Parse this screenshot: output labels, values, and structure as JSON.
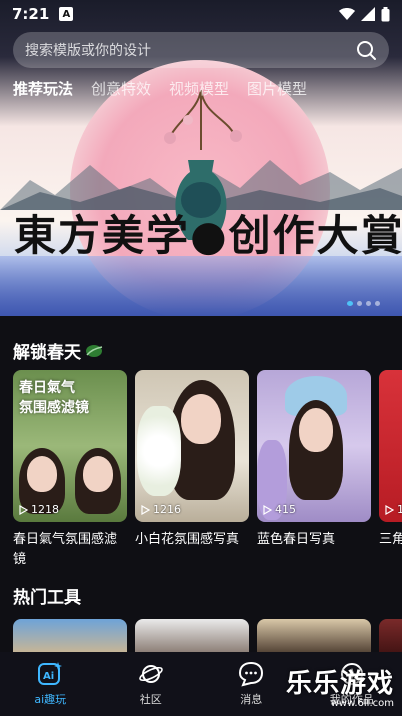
{
  "status_bar": {
    "time": "7:21",
    "notification_letter": "A"
  },
  "search": {
    "placeholder": "搜索模版或你的设计"
  },
  "top_tabs": [
    {
      "label": "推荐玩法",
      "active": true
    },
    {
      "label": "创意特效",
      "active": false
    },
    {
      "label": "视频模型",
      "active": false
    },
    {
      "label": "图片模型",
      "active": false
    }
  ],
  "banner": {
    "title": "東方美学",
    "title_right": "创作大賞",
    "slides": 4,
    "current_slide": 1
  },
  "section_spring": {
    "title": "解锁春天",
    "cards": [
      {
        "overlay": "春日氣气\n氛围感滤镜",
        "count": "1218",
        "label": "春日氣气氛围感滤镜"
      },
      {
        "overlay": "",
        "count": "1216",
        "label": "小白花氛围感写真"
      },
      {
        "overlay": "",
        "count": "415",
        "label": "蓝色春日写真"
      },
      {
        "overlay": "",
        "count": "1",
        "label": "三角"
      }
    ]
  },
  "section_tools": {
    "title": "热门工具"
  },
  "bottom_nav": [
    {
      "label": "ai趣玩",
      "icon": "ai-icon",
      "active": true
    },
    {
      "label": "社区",
      "icon": "planet-icon",
      "active": false
    },
    {
      "label": "消息",
      "icon": "chat-icon",
      "active": false
    },
    {
      "label": "我的作品",
      "icon": "works-icon",
      "active": false
    }
  ],
  "watermark": {
    "text": "乐乐游戏",
    "url": "www.6ll.com"
  },
  "colors": {
    "accent": "#3fb7ff",
    "background": "#0f0f14"
  }
}
